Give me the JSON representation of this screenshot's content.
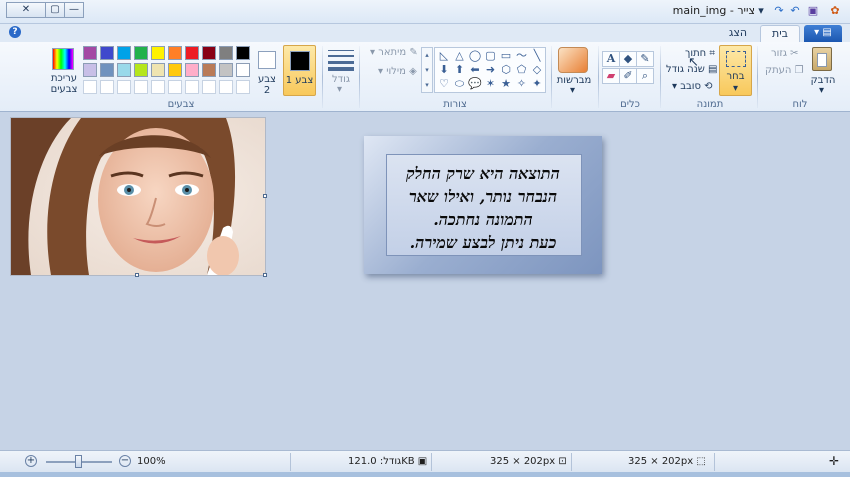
{
  "window": {
    "title": "main_img - צייר",
    "close_glyph": "✕",
    "maximize_glyph": "▢",
    "minimize_glyph": "—"
  },
  "tabs": {
    "file": "▾ ▤",
    "home": "בית",
    "view": "הצג",
    "help": "?"
  },
  "clipboard": {
    "paste": "הדבק",
    "cut": "גזור",
    "copy": "העתק",
    "group": "לוח"
  },
  "image_group": {
    "select": "בחר",
    "crop": "חתוך",
    "resize": "שנה גודל",
    "rotate": "סובב",
    "group": "תמונה"
  },
  "tools_group": {
    "group": "כלים"
  },
  "brushes": {
    "label": "מברשות"
  },
  "shapes_group": {
    "outline": "מיתאר",
    "fill": "מילוי",
    "group": "צורות"
  },
  "size": {
    "label": "גודל"
  },
  "colors": {
    "color1": "צבע 1",
    "color2": "צבע 2",
    "edit": "עריכת צבעים",
    "group": "צבעים",
    "color1_value": "#000000",
    "color2_value": "#ffffff",
    "row1": [
      "#000000",
      "#7f7f7f",
      "#880015",
      "#ed1c24",
      "#ff7f27",
      "#fff200",
      "#22b14c",
      "#00a2e8",
      "#3f48cc",
      "#a349a4"
    ],
    "row2": [
      "#ffffff",
      "#c3c3c3",
      "#b97a57",
      "#ffaec9",
      "#ffc90e",
      "#efe4b0",
      "#b5e61d",
      "#99d9ea",
      "#7092be",
      "#c8bfe7"
    ],
    "row3_count": 10
  },
  "canvas_text": {
    "line1": "התוצאה היא שרק החלק",
    "line2": "הנבחר נותר, ואילו שאר",
    "line3": "התמונה נחתכה.",
    "line4": "כעת ניתן לבצע שמירה."
  },
  "status": {
    "selection_size": "325 × 202px",
    "image_size": "325 × 202px",
    "file_size": "גודל: 121.0KB",
    "zoom": "100%"
  }
}
